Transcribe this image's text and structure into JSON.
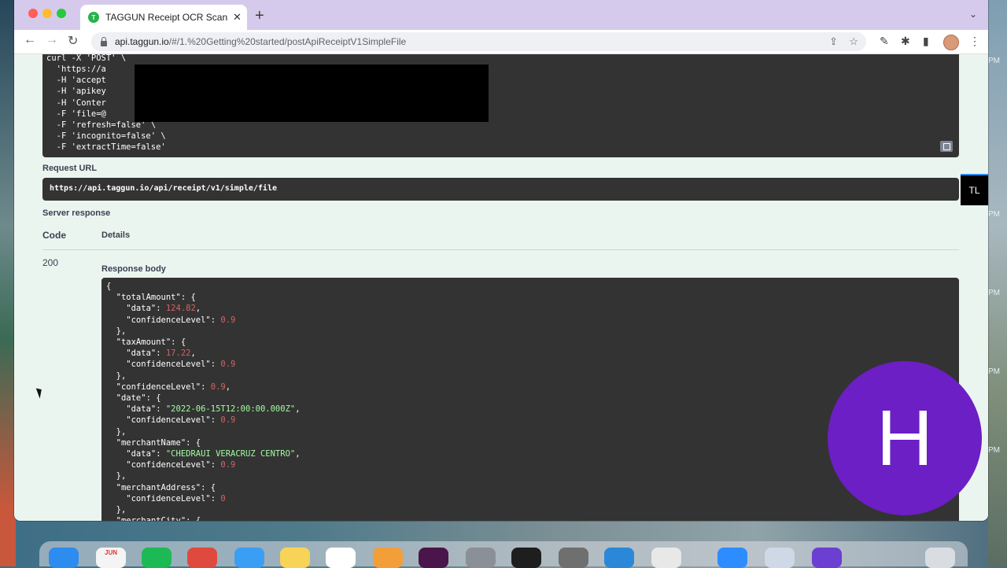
{
  "browser": {
    "tab_title": "TAGGUN Receipt OCR Scannin",
    "tab_close": "✕",
    "new_tab": "+",
    "tab_menu": "⌄",
    "url_host": "api.taggun.io",
    "url_path": "/#/1.%20Getting%20started/postApiReceiptV1SimpleFile",
    "back": "←",
    "forward": "→",
    "reload": "↻",
    "share": "⇪",
    "bookmark": "☆",
    "extensions": "✱",
    "sidepanel": "▮",
    "more": "⋮",
    "favicon_letter": "T",
    "extension_badge": "TL"
  },
  "curl": {
    "lines": [
      "curl -X 'POST' \\",
      "  'https://a",
      "  -H 'accept",
      "  -H 'apikey",
      "  -H 'Conter",
      "  -F 'file=@",
      "  -F 'refresh=false' \\",
      "  -F 'incognito=false' \\",
      "  -F 'extractTime=false'"
    ]
  },
  "request_url_label": "Request URL",
  "request_url": "https://api.taggun.io/api/receipt/v1/simple/file",
  "server_response_label": "Server response",
  "columns": {
    "code": "Code",
    "details": "Details"
  },
  "response_code": "200",
  "response_body_label": "Response body",
  "response_body": [
    [
      "{",
      "",
      ""
    ],
    [
      "  \"totalAmount\": {",
      "",
      ""
    ],
    [
      "    \"data\": ",
      "124.82",
      "num"
    ],
    [
      "    \"confidenceLevel\": ",
      "0.9",
      "num"
    ],
    [
      "  },",
      "",
      ""
    ],
    [
      "  \"taxAmount\": {",
      "",
      ""
    ],
    [
      "    \"data\": ",
      "17.22",
      "num"
    ],
    [
      "    \"confidenceLevel\": ",
      "0.9",
      "num"
    ],
    [
      "  },",
      "",
      ""
    ],
    [
      "  \"confidenceLevel\": ",
      "0.9",
      "num"
    ],
    [
      "  \"date\": {",
      "",
      ""
    ],
    [
      "    \"data\": ",
      "\"2022-06-15T12:00:00.000Z\"",
      "str"
    ],
    [
      "    \"confidenceLevel\": ",
      "0.9",
      "num"
    ],
    [
      "  },",
      "",
      ""
    ],
    [
      "  \"merchantName\": {",
      "",
      ""
    ],
    [
      "    \"data\": ",
      "\"CHEDRAUI VERACRUZ CENTRO\"",
      "str"
    ],
    [
      "    \"confidenceLevel\": ",
      "0.9",
      "num"
    ],
    [
      "  },",
      "",
      ""
    ],
    [
      "  \"merchantAddress\": {",
      "",
      ""
    ],
    [
      "    \"confidenceLevel\": ",
      "0",
      "num"
    ],
    [
      "  },",
      "",
      ""
    ],
    [
      "  \"merchantCity\": {",
      "",
      ""
    ]
  ],
  "avatar_letter": "H",
  "desktop_times": [
    "PM",
    "PM",
    "PM",
    "PM",
    "PM"
  ],
  "dock": {
    "calendar_month": "JUN"
  },
  "colors": {
    "tabstrip": "#d6caec",
    "code_bg": "#333333",
    "page_bg": "#ebf5ef",
    "avatar": "#6b1fc4",
    "json_number": "#d36363",
    "json_string": "#a2fca2"
  }
}
